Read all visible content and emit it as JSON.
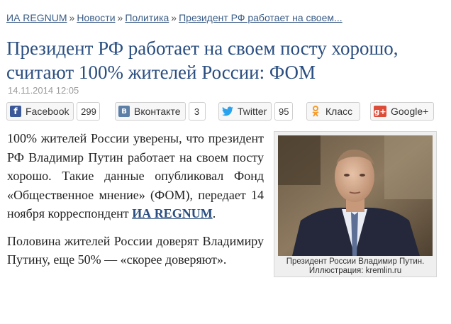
{
  "breadcrumb": {
    "items": [
      "ИА REGNUM",
      "Новости",
      "Политика",
      "Президент РФ работает на своем..."
    ],
    "separator": "»"
  },
  "article": {
    "title": "Президент РФ работает на своем посту хорошо, считают 100% жителей России: ФОМ",
    "date": "14.11.2014 12:05",
    "p1_text": "100% жителей России уверены, что президент РФ Владимир Путин работает на своем посту хорошо. Такие данные опубликовал Фонд «Общественное мнение» (ФОМ), передает 14 ноября корреспондент ",
    "p1_link": "ИА REGNUM",
    "p1_end": ".",
    "p2_text": "Половина жителей России доверят Владимиру Путину, еще 50% — «скорее доверяют»."
  },
  "share": {
    "facebook": {
      "label": "Facebook",
      "count": "299",
      "icon": "facebook-icon",
      "color": "#3b5998"
    },
    "vkontakte": {
      "label": "Вконтакте",
      "count": "3",
      "icon": "vk-icon",
      "color": "#5b7fa6"
    },
    "twitter": {
      "label": "Twitter",
      "count": "95",
      "icon": "twitter-icon",
      "color": "#2aa3ef"
    },
    "ok": {
      "label": "Класс",
      "icon": "odnoklassniki-icon",
      "color": "#f59a2a"
    },
    "gplus": {
      "label": "Google+",
      "icon": "google-plus-icon",
      "color": "#dd4b39"
    }
  },
  "figure": {
    "caption_line1": "Президент России Владимир Путин.",
    "caption_line2": "Иллюстрация: kremlin.ru"
  },
  "colors": {
    "title": "#2a4e80",
    "link": "#3a5c86"
  }
}
